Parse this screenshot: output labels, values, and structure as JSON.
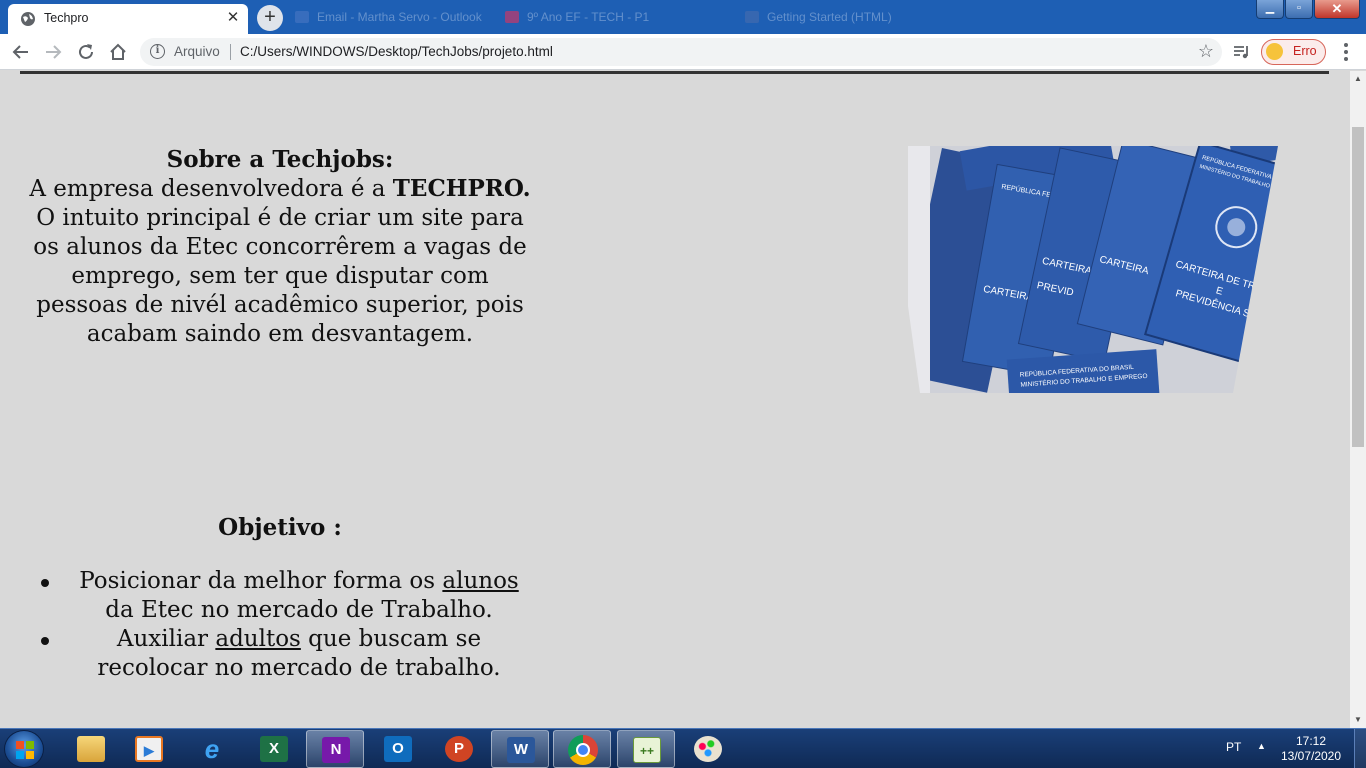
{
  "browser": {
    "tab_title": "Techpro",
    "tab_close": "✕",
    "new_tab": "+",
    "background_tabs": [
      "Email - Martha Servo - Outlook",
      "9º Ano EF - TECH - P1",
      "Getting Started (HTML)"
    ],
    "address_scheme": "Arquivo",
    "address_url": "C:/Users/WINDOWS/Desktop/TechJobs/projeto.html",
    "profile_label": "Erro",
    "window_controls": {
      "minimize": "▁",
      "maximize": "▫",
      "close": "✕"
    }
  },
  "page": {
    "about": {
      "heading": "Sobre a Techjobs:",
      "intro": "A empresa desenvolvedora é a ",
      "company": "TECHPRO.",
      "body": "O intuito principal é de criar um site para os alunos da Etec concorrêrem a vagas de emprego, sem ter que disputar com pessoas de nivél acadêmico superior, pois acabam saindo em desvantagem."
    },
    "image": {
      "alt": "Carteiras de trabalho",
      "booklet_texts": [
        "REPÚBLICA FEDERATIVA DO BRASIL",
        "MINISTÉRIO DO TRABALHO E EMPREGO",
        "CARTEIRA DE TRABALHO",
        "E",
        "PREVIDÊNCIA SOCIAL",
        "CARTEIRA",
        "PREVID"
      ]
    },
    "objective": {
      "heading": "Objetivo :",
      "items": [
        {
          "pre": "Posicionar da melhor forma os ",
          "link": "alunos",
          "post": " da Etec no mercado de Trabalho."
        },
        {
          "pre": "Auxiliar ",
          "link": "adultos",
          "post": " que buscam se recolocar no mercado de trabalho."
        }
      ]
    }
  },
  "taskbar": {
    "apps": [
      {
        "name": "file-explorer",
        "label": ""
      },
      {
        "name": "media-player",
        "label": ""
      },
      {
        "name": "internet-explorer",
        "label": "e"
      },
      {
        "name": "excel",
        "label": "X"
      },
      {
        "name": "onenote",
        "label": "N"
      },
      {
        "name": "outlook",
        "label": "O"
      },
      {
        "name": "powerpoint",
        "label": "P"
      },
      {
        "name": "word",
        "label": "W"
      },
      {
        "name": "chrome",
        "label": ""
      },
      {
        "name": "notepad-plus",
        "label": ""
      },
      {
        "name": "paint",
        "label": ""
      }
    ],
    "language": "PT",
    "time": "17:12",
    "date": "13/07/2020"
  },
  "colors": {
    "tabstrip": "#1e5fb4",
    "page_bg": "#d9d9d9",
    "booklet_blue": "#2f5aa8",
    "profile_red": "#c5221f"
  }
}
